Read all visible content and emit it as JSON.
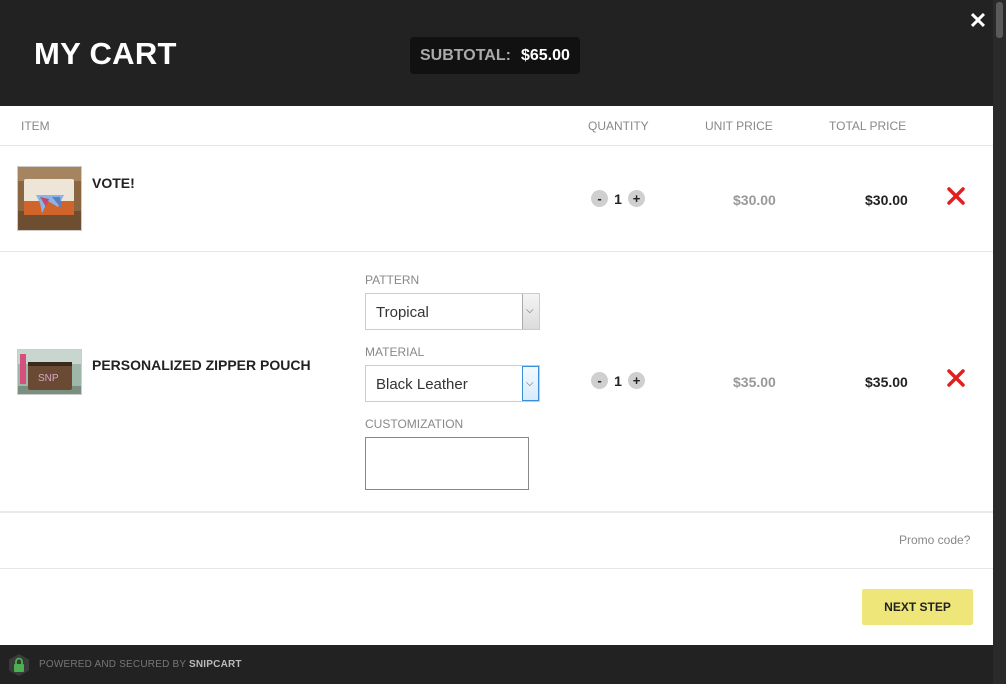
{
  "header": {
    "title": "MY CART",
    "subtotal_label": "SUBTOTAL:",
    "subtotal_value": "$65.00",
    "close_glyph": "✕"
  },
  "columns": {
    "item": "ITEM",
    "quantity": "QUANTITY",
    "unit_price": "UNIT PRICE",
    "total_price": "TOTAL PRICE"
  },
  "items": [
    {
      "name": "VOTE!",
      "quantity": "1",
      "unit_price": "$30.00",
      "total_price": "$30.00"
    },
    {
      "name": "PERSONALIZED ZIPPER POUCH",
      "quantity": "1",
      "unit_price": "$35.00",
      "total_price": "$35.00",
      "fields": {
        "pattern_label": "PATTERN",
        "pattern_value": "Tropical",
        "material_label": "MATERIAL",
        "material_value": "Black Leather",
        "customization_label": "CUSTOMIZATION",
        "customization_value": ""
      }
    }
  ],
  "qty_minus": "-",
  "qty_plus": "+",
  "promo": "Promo code?",
  "next_step": "NEXT STEP",
  "footer": {
    "powered": "POWERED AND SECURED BY",
    "brand": "SNIPCART"
  },
  "colors": {
    "header_bg": "#222222",
    "accent_button": "#efe67a",
    "remove_red": "#e02020"
  },
  "icons": [
    "close-icon",
    "remove-icon",
    "lock-icon",
    "chevron-down-icon"
  ]
}
